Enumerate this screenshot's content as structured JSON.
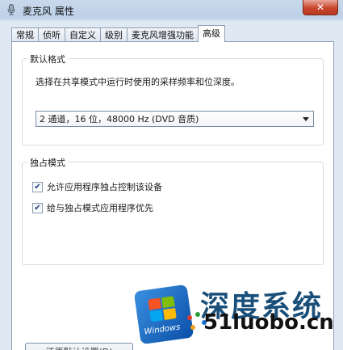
{
  "window": {
    "title": "麦克风 属性",
    "close_label": "✕"
  },
  "tabs": [
    {
      "label": "常规",
      "active": false
    },
    {
      "label": "侦听",
      "active": false
    },
    {
      "label": "自定义",
      "active": false
    },
    {
      "label": "级别",
      "active": false
    },
    {
      "label": "麦克风增强功能",
      "active": false
    },
    {
      "label": "高级",
      "active": true
    }
  ],
  "default_format": {
    "group_title": "默认格式",
    "description": "选择在共享模式中运行时使用的采样频率和位深度。",
    "selected_format": "2 通道，16 位，48000 Hz (DVD 音质)"
  },
  "exclusive_mode": {
    "group_title": "独占模式",
    "options": [
      {
        "label": "允许应用程序独占控制该设备",
        "checked": true
      },
      {
        "label": "给与独占模式应用程序优先",
        "checked": true
      }
    ]
  },
  "restore_button_label": "还原默认设置(D)",
  "watermark": {
    "logo_text": "Windows",
    "chinese_text": "深度系统",
    "url_text": "51luobo.cn"
  },
  "colors": {
    "close_button": "#c9462c",
    "watermark_blue": "#1a4f7a"
  }
}
